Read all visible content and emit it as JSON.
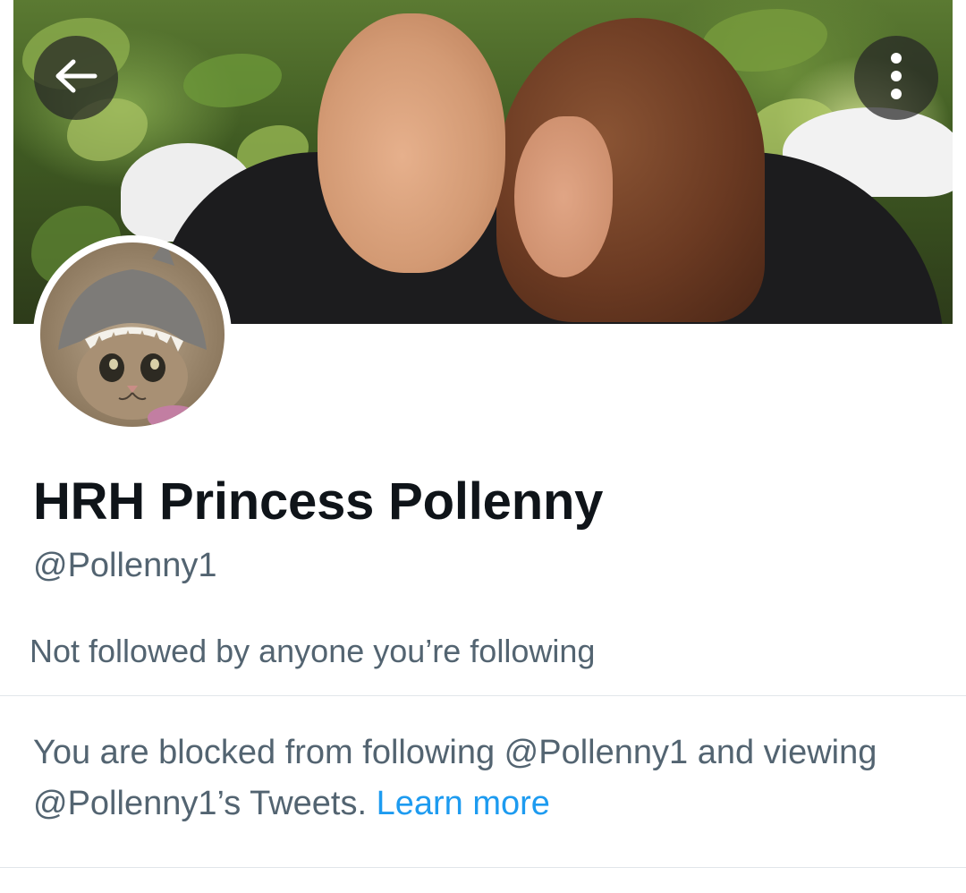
{
  "header": {
    "back_icon": "arrow-left-icon",
    "more_icon": "more-vertical-icon"
  },
  "profile": {
    "display_name": "HRH Princess Pollenny",
    "handle": "@Pollenny1",
    "followers_note": "Not followed by anyone you’re following"
  },
  "blocked_notice": {
    "text": "You are blocked from following @Pollenny1 and viewing @Pollenny1’s Tweets.",
    "link_label": "Learn more",
    "link_color": "#1d9bf0"
  },
  "colors": {
    "name": "#0f1419",
    "secondary_text": "#536471",
    "divider": "#e1e6ea",
    "accent": "#1d9bf0"
  }
}
